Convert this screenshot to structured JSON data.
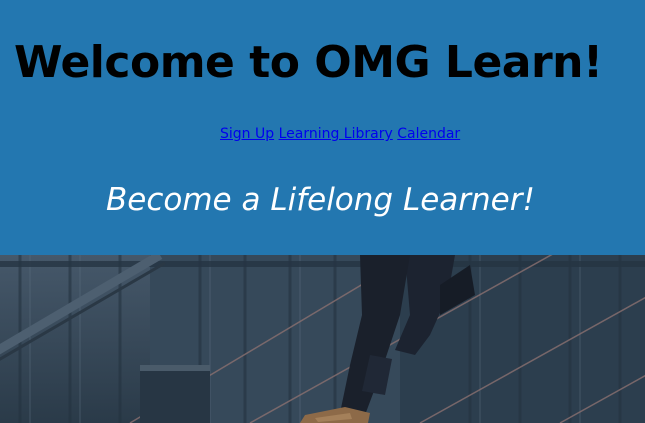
{
  "header": {
    "title": "Welcome to OMG Learn!",
    "tagline": "Become a Lifelong Learner!",
    "background_color": "#2377b0"
  },
  "nav": {
    "links": [
      {
        "label": "Sign Up"
      },
      {
        "label": "Learning Library"
      },
      {
        "label": "Calendar"
      }
    ],
    "link_color": "#0000ee"
  },
  "hero": {
    "image": "photo of a person in dark jeans walking down an outdoor metal staircase"
  }
}
